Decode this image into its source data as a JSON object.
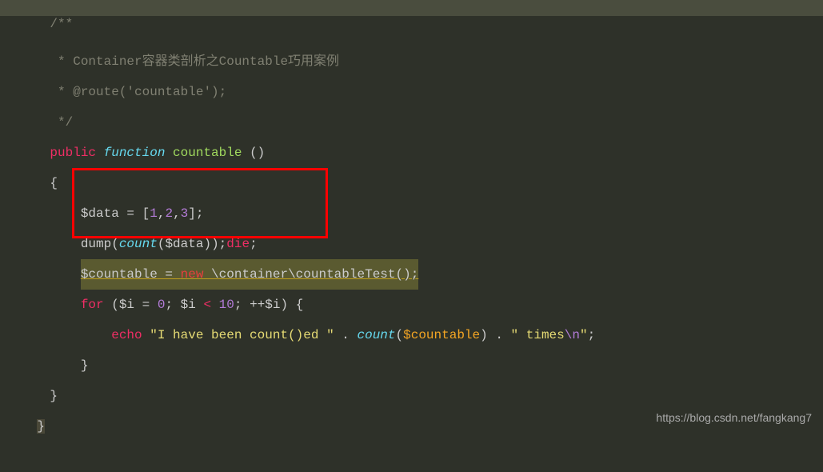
{
  "watermark": "https://blog.csdn.net/fangkang7",
  "code": {
    "c1": "/**",
    "c2": " * Container容器类剖析之Countable巧用案例",
    "c3": " * @route('countable');",
    "c4": " */",
    "l5_public": "public",
    "l5_function": "function",
    "l5_name": "countable",
    "l5_paren": " ()",
    "l6": "{",
    "l7_var": "$data",
    "l7_eq": " = [",
    "l7_n1": "1",
    "l7_c1": ",",
    "l7_n2": "2",
    "l7_c2": ",",
    "l7_n3": "3",
    "l7_end": "];",
    "l8_dump": "dump",
    "l8_p1": "(",
    "l8_count": "count",
    "l8_p2": "(",
    "l8_var": "$data",
    "l8_p3": "));",
    "l8_die": "die",
    "l8_semi": ";",
    "l9_var": "$countable",
    "l9_eq": " = ",
    "l9_new": "new",
    "l9_class": " \\container\\countableTest();",
    "l10_for": "for",
    "l10_p1": " (",
    "l10_var1": "$i",
    "l10_eq1": " = ",
    "l10_n1": "0",
    "l10_sc1": "; ",
    "l10_var2": "$i",
    "l10_lt": " < ",
    "l10_n2": "10",
    "l10_sc2": "; ++",
    "l10_var3": "$i",
    "l10_p2": ") {",
    "l11_echo": "echo",
    "l11_s1": " \"I have been count()ed \"",
    "l11_dot1": " . ",
    "l11_count": "count",
    "l11_p1": "(",
    "l11_var": "$countable",
    "l11_p2": ") . ",
    "l11_s2": "\" times",
    "l11_esc": "\\n",
    "l11_s3": "\"",
    "l11_semi": ";",
    "l12": "}",
    "l13": "}",
    "l14": "}"
  }
}
